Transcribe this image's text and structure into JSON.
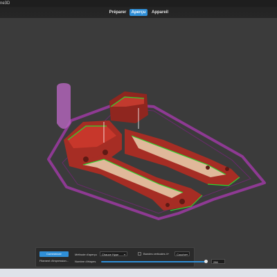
{
  "window": {
    "title": "ne3D"
  },
  "nav": {
    "tabs": [
      {
        "label": "Préparer"
      },
      {
        "label": "Aperçu"
      },
      {
        "label": "Appareil"
      }
    ],
    "active_tab": "Aperçu"
  },
  "panel": {
    "primary_button": "Commencer",
    "second_label": "Filament d'impression...",
    "method_label": "Méthode d'aperçu",
    "method_value": "Chauve Hype",
    "checkbox_label": "Bandes verticales 4+",
    "right_select_value": "Couche",
    "slider_label": "Nombre d'étapes",
    "slider_value": "286",
    "slider_level": 0.98
  },
  "colors": {
    "accent": "#2f8fd8",
    "model": "#a62d24",
    "infill": "#e0b89a",
    "skirt": "#8e3a93",
    "wall": "#2ed52e"
  }
}
